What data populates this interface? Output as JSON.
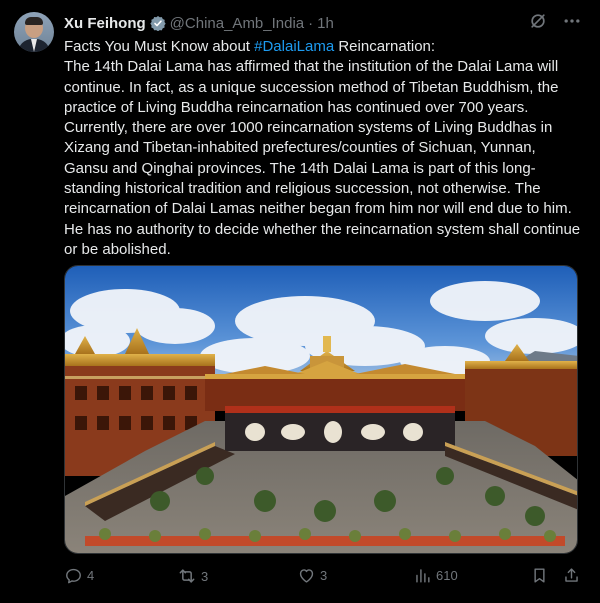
{
  "author": {
    "name": "Xu Feihong",
    "handle": "@China_Amb_India",
    "separator": "·",
    "time": "1h"
  },
  "post": {
    "line1_prefix": "Facts You Must Know about ",
    "hashtag": "#DalaiLama",
    "line1_suffix": " Reincarnation:",
    "body": "The 14th Dalai Lama has affirmed that the institution of the Dalai Lama will continue. In fact, as a unique succession method of Tibetan Buddhism, the practice of Living Buddha reincarnation has continued over 700 years. Currently, there are over 1000 reincarnation systems of Living Buddhas in Xizang and Tibetan-inhabited prefectures/counties of Sichuan, Yunnan, Gansu and Qinghai provinces. The 14th Dalai Lama is part of this long-standing historical tradition and religious succession, not otherwise. The reincarnation of Dalai Lamas neither began from him nor will end due to him. He has no authority to decide whether the reincarnation system shall continue or be abolished."
  },
  "media": {
    "description": "Photo of a Tibetan temple courtyard with golden roofs"
  },
  "actions": {
    "replies": "4",
    "reposts": "3",
    "likes": "3",
    "views": "610"
  },
  "colors": {
    "background": "#000000",
    "text": "#e7e9ea",
    "secondary": "#71767b",
    "accent": "#1d9bf0"
  }
}
